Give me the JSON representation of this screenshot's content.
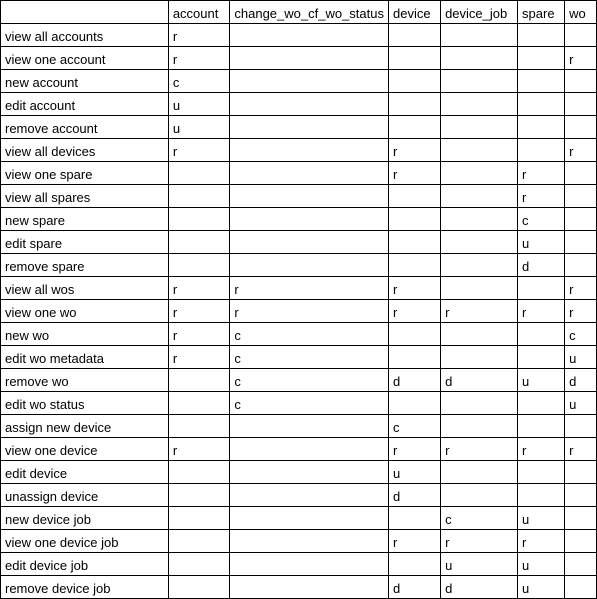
{
  "columns": [
    "account",
    "change_wo_cf_wo_status",
    "device",
    "device_job",
    "spare",
    "wo"
  ],
  "rows": [
    {
      "label": "view all accounts",
      "cells": [
        "r",
        "",
        "",
        "",
        "",
        ""
      ]
    },
    {
      "label": "view one account",
      "cells": [
        "r",
        "",
        "",
        "",
        "",
        "r"
      ]
    },
    {
      "label": "new account",
      "cells": [
        "c",
        "",
        "",
        "",
        "",
        ""
      ]
    },
    {
      "label": "edit account",
      "cells": [
        "u",
        "",
        "",
        "",
        "",
        ""
      ]
    },
    {
      "label": "remove account",
      "cells": [
        "u",
        "",
        "",
        "",
        "",
        ""
      ]
    },
    {
      "label": "view all devices",
      "cells": [
        "r",
        "",
        "r",
        "",
        "",
        "r"
      ]
    },
    {
      "label": "view one spare",
      "cells": [
        "",
        "",
        "r",
        "",
        "r",
        ""
      ]
    },
    {
      "label": "view all spares",
      "cells": [
        "",
        "",
        "",
        "",
        "r",
        ""
      ]
    },
    {
      "label": "new spare",
      "cells": [
        "",
        "",
        "",
        "",
        "c",
        ""
      ]
    },
    {
      "label": "edit spare",
      "cells": [
        "",
        "",
        "",
        "",
        "u",
        ""
      ]
    },
    {
      "label": "remove spare",
      "cells": [
        "",
        "",
        "",
        "",
        "d",
        ""
      ]
    },
    {
      "label": "view all wos",
      "cells": [
        "r",
        "r",
        "r",
        "",
        "",
        "r"
      ]
    },
    {
      "label": "view one wo",
      "cells": [
        "r",
        "r",
        "r",
        "r",
        "r",
        "r"
      ]
    },
    {
      "label": "new wo",
      "cells": [
        "r",
        "c",
        "",
        "",
        "",
        "c"
      ]
    },
    {
      "label": "edit wo metadata",
      "cells": [
        "r",
        "c",
        "",
        "",
        "",
        "u"
      ]
    },
    {
      "label": "remove wo",
      "cells": [
        "",
        "c",
        "d",
        "d",
        "u",
        "d"
      ]
    },
    {
      "label": "edit wo status",
      "cells": [
        "",
        "c",
        "",
        "",
        "",
        "u"
      ]
    },
    {
      "label": "assign new device",
      "cells": [
        "",
        "",
        "c",
        "",
        "",
        ""
      ]
    },
    {
      "label": "view one device",
      "cells": [
        "r",
        "",
        "r",
        "r",
        "r",
        "r"
      ]
    },
    {
      "label": "edit device",
      "cells": [
        "",
        "",
        "u",
        "",
        "",
        ""
      ]
    },
    {
      "label": "unassign device",
      "cells": [
        "",
        "",
        "d",
        "",
        "",
        ""
      ]
    },
    {
      "label": "new device job",
      "cells": [
        "",
        "",
        "",
        "c",
        "u",
        ""
      ]
    },
    {
      "label": "view one device job",
      "cells": [
        "",
        "",
        "r",
        "r",
        "r",
        ""
      ]
    },
    {
      "label": "edit device job",
      "cells": [
        "",
        "",
        "",
        "u",
        "u",
        ""
      ]
    },
    {
      "label": "remove device job",
      "cells": [
        "",
        "",
        "d",
        "d",
        "u",
        ""
      ]
    }
  ]
}
